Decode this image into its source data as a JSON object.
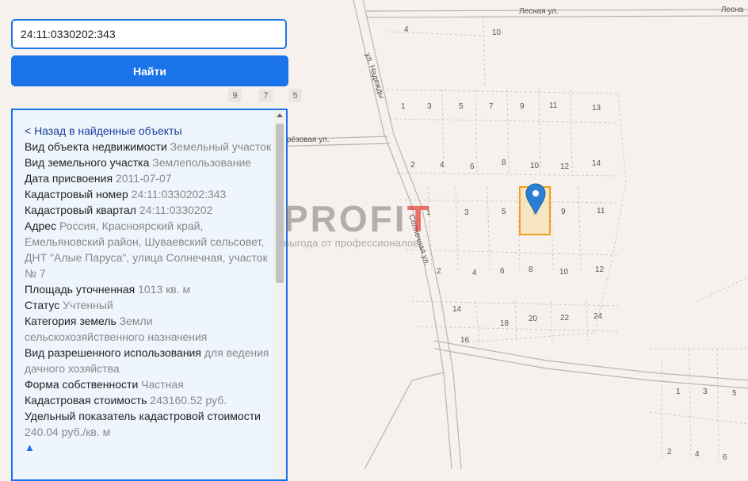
{
  "search": {
    "value": "24:11:0330202:343"
  },
  "find_button": {
    "label": "Найти"
  },
  "zoom_chips": [
    "9",
    "7",
    "5"
  ],
  "info": {
    "back_link": "< Назад в найденные объекты",
    "rows": [
      {
        "label": "Вид объекта недвижимости",
        "value": "Земельный участок"
      },
      {
        "label": "Вид земельного участка",
        "value": "Землепользование"
      },
      {
        "label": "Дата присвоения",
        "value": "2011-07-07"
      },
      {
        "label": "Кадастровый номер",
        "value": "24:11:0330202:343"
      },
      {
        "label": "Кадастровый квартал",
        "value": "24:11:0330202"
      },
      {
        "label": "Адрес",
        "value": "Россия, Красноярский край, Емельяновский район, Шуваевский сельсовет, ДНТ \"Алые Паруса\", улица Солнечная, участок № 7"
      },
      {
        "label": "Площадь уточненная",
        "value": "1013 кв. м"
      },
      {
        "label": "Статус",
        "value": "Учтенный"
      },
      {
        "label": "Категория земель",
        "value": "Земли сельскохозяйственного назначения"
      },
      {
        "label": "Вид разрешенного использования",
        "value": "для ведения дачного хозяйства"
      },
      {
        "label": "Форма собственности",
        "value": "Частная"
      },
      {
        "label": "Кадастровая стоимость",
        "value": "243160.52 руб."
      },
      {
        "label": "Удельный показатель кадастровой стоимости",
        "value": "240.04 руб./кв. м"
      }
    ],
    "collapse_arrow": "▲"
  },
  "map": {
    "streets": {
      "lesnaya_1": "Лесная ул.",
      "lesnaya_2": "Лесна",
      "nadezhdy": "ул. Надежды",
      "berezovaya": "рёзовая ул.",
      "solnechnaya": "Солнечная ул."
    },
    "plot_numbers": [
      "4",
      "10",
      "1",
      "3",
      "5",
      "7",
      "9",
      "11",
      "13",
      "2",
      "4",
      "6",
      "8",
      "10",
      "12",
      "14",
      "1",
      "3",
      "5",
      "7",
      "9",
      "11",
      "2",
      "4",
      "6",
      "8",
      "10",
      "12",
      "14",
      "18",
      "20",
      "22",
      "24",
      "16",
      "1",
      "3",
      "5",
      "2",
      "4",
      "6"
    ],
    "colors": {
      "selected_plot": "#f0a020",
      "marker": "#2a7fd4"
    }
  },
  "watermark": {
    "logo_main": "PROFI",
    "logo_accent": "T",
    "tagline": "выгода от профессионалов"
  }
}
